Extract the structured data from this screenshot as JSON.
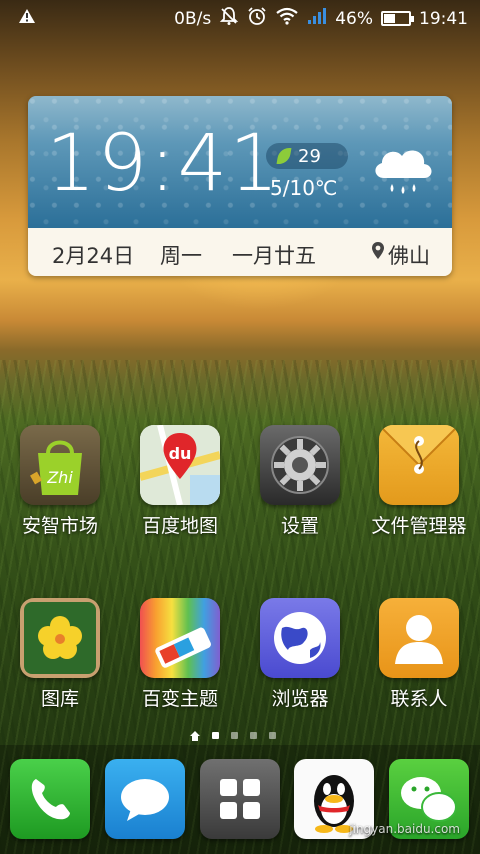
{
  "status_bar": {
    "network_speed": "0B/s",
    "battery_percent": "46%",
    "battery_level": 0.46,
    "time": "19:41"
  },
  "weather_widget": {
    "time": "19:41",
    "aqi": "29",
    "temperature": "5/10℃",
    "date": "2月24日",
    "weekday": "周一",
    "lunar_date": "一月廿五",
    "city": "佛山",
    "condition_icon": "rain-cloud-icon"
  },
  "apps": [
    {
      "label": "安智市场",
      "icon": "anzhi-market-icon"
    },
    {
      "label": "百度地图",
      "icon": "baidu-map-icon"
    },
    {
      "label": "设置",
      "icon": "settings-gear-icon"
    },
    {
      "label": "文件管理器",
      "icon": "file-manager-icon"
    },
    {
      "label": "图库",
      "icon": "gallery-icon"
    },
    {
      "label": "百变主题",
      "icon": "theme-icon"
    },
    {
      "label": "浏览器",
      "icon": "browser-icon"
    },
    {
      "label": "联系人",
      "icon": "contacts-icon"
    }
  ],
  "dock": [
    {
      "icon": "phone-icon"
    },
    {
      "icon": "messages-icon"
    },
    {
      "icon": "app-drawer-icon"
    },
    {
      "icon": "qq-icon"
    },
    {
      "icon": "wechat-icon"
    }
  ],
  "page_indicator": {
    "pages": 4,
    "current": 1
  },
  "watermark": "jingyan.baidu.com"
}
